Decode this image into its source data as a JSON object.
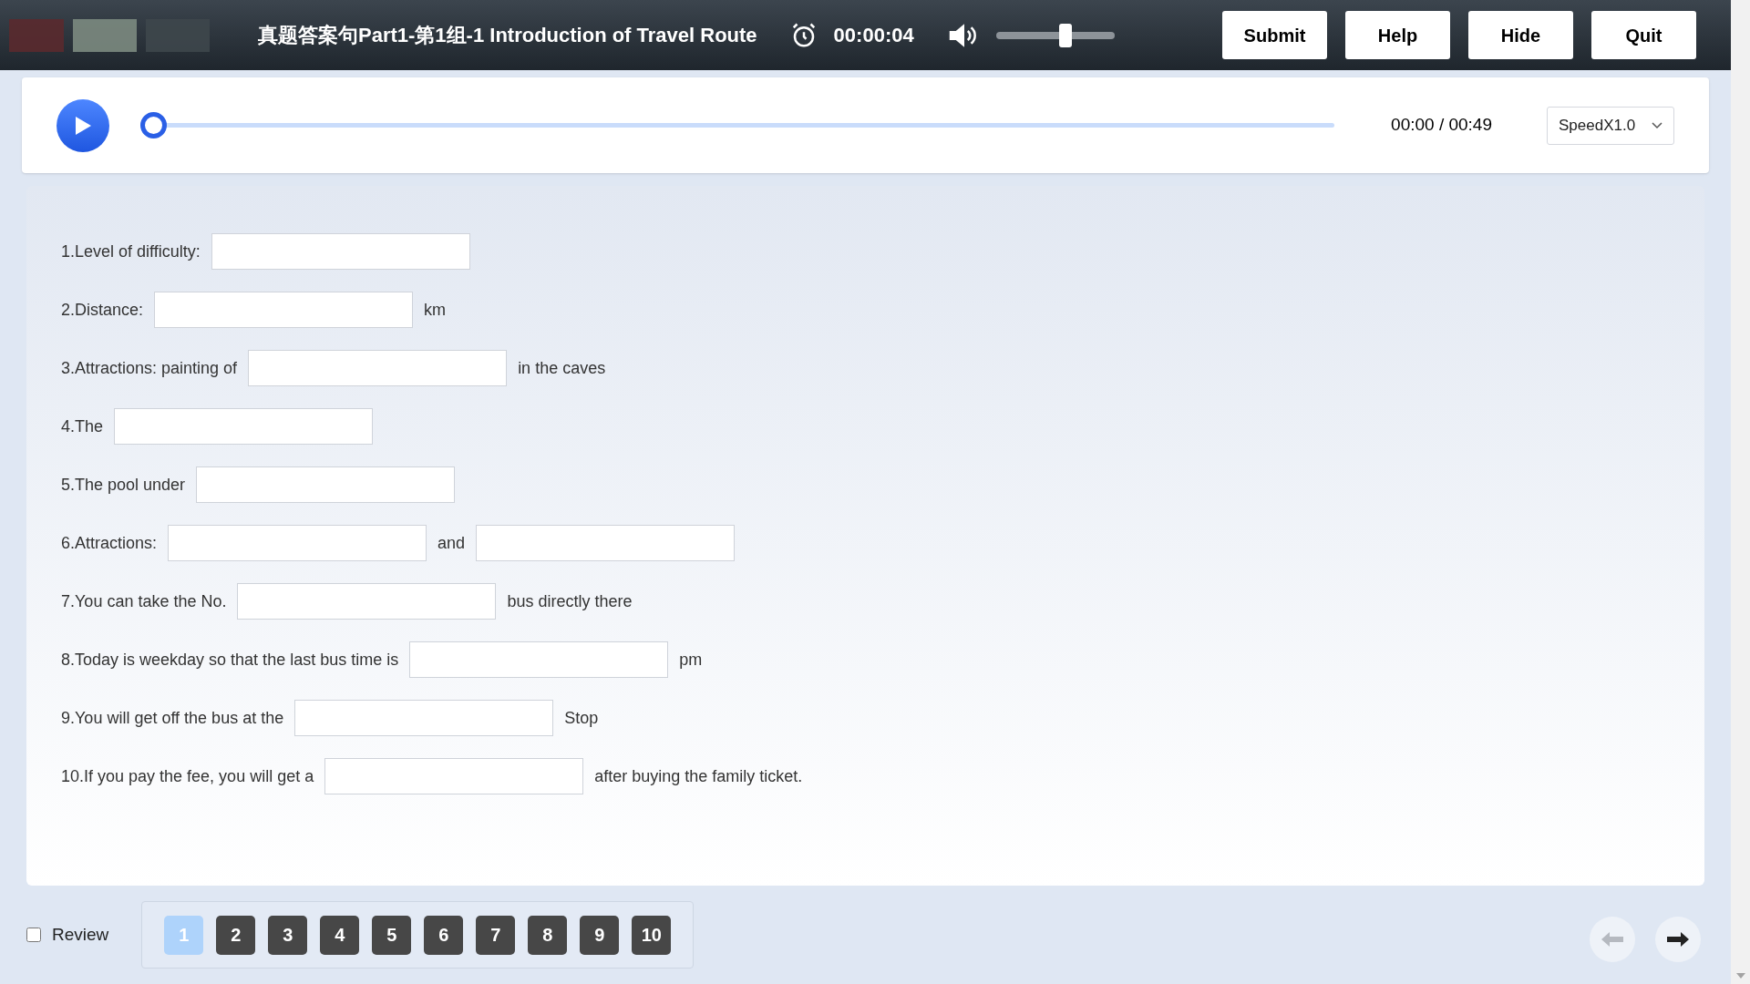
{
  "header": {
    "title": "真题答案句Part1-第1组-1 Introduction of Travel Route",
    "timer": "00:00:04",
    "volume": {
      "level": 0.6
    },
    "buttons": [
      "Submit",
      "Help",
      "Hide",
      "Quit"
    ]
  },
  "player": {
    "progress": {
      "level": 0
    },
    "time": "00:00 / 00:49",
    "speed": "SpeedX1.0"
  },
  "questions": [
    {
      "parts": [
        {
          "kind": "text",
          "text": "1.Level of difficulty:"
        },
        {
          "kind": "blank"
        }
      ]
    },
    {
      "parts": [
        {
          "kind": "text",
          "text": "2.Distance:"
        },
        {
          "kind": "blank"
        },
        {
          "kind": "text",
          "text": "km"
        }
      ]
    },
    {
      "parts": [
        {
          "kind": "text",
          "text": "3.Attractions: painting of"
        },
        {
          "kind": "blank"
        },
        {
          "kind": "text",
          "text": "in the caves"
        }
      ]
    },
    {
      "parts": [
        {
          "kind": "text",
          "text": "4.The"
        },
        {
          "kind": "blank"
        }
      ]
    },
    {
      "parts": [
        {
          "kind": "text",
          "text": "5.The pool under"
        },
        {
          "kind": "blank"
        }
      ]
    },
    {
      "parts": [
        {
          "kind": "text",
          "text": "6.Attractions:"
        },
        {
          "kind": "blank"
        },
        {
          "kind": "text",
          "text": "and"
        },
        {
          "kind": "blank"
        }
      ]
    },
    {
      "parts": [
        {
          "kind": "text",
          "text": "7.You can take the No."
        },
        {
          "kind": "blank"
        },
        {
          "kind": "text",
          "text": "bus directly there"
        }
      ]
    },
    {
      "parts": [
        {
          "kind": "text",
          "text": "8.Today is weekday so that the last bus time is"
        },
        {
          "kind": "blank"
        },
        {
          "kind": "text",
          "text": "pm"
        }
      ]
    },
    {
      "parts": [
        {
          "kind": "text",
          "text": "9.You will get off the bus at the"
        },
        {
          "kind": "blank"
        },
        {
          "kind": "text",
          "text": "Stop"
        }
      ]
    },
    {
      "parts": [
        {
          "kind": "text",
          "text": "10.If you pay the fee, you will get a"
        },
        {
          "kind": "blank"
        },
        {
          "kind": "text",
          "text": "after buying the family ticket."
        }
      ]
    }
  ],
  "footer": {
    "review": {
      "label": "Review",
      "checked": false
    },
    "pages": [
      {
        "label": "1",
        "selected": true
      },
      {
        "label": "2",
        "selected": false
      },
      {
        "label": "3",
        "selected": false
      },
      {
        "label": "4",
        "selected": false
      },
      {
        "label": "5",
        "selected": false
      },
      {
        "label": "6",
        "selected": false
      },
      {
        "label": "7",
        "selected": false
      },
      {
        "label": "8",
        "selected": false
      },
      {
        "label": "9",
        "selected": false
      },
      {
        "label": "10",
        "selected": false
      }
    ],
    "prev": {
      "disabled": true
    },
    "next": {
      "disabled": false
    }
  }
}
